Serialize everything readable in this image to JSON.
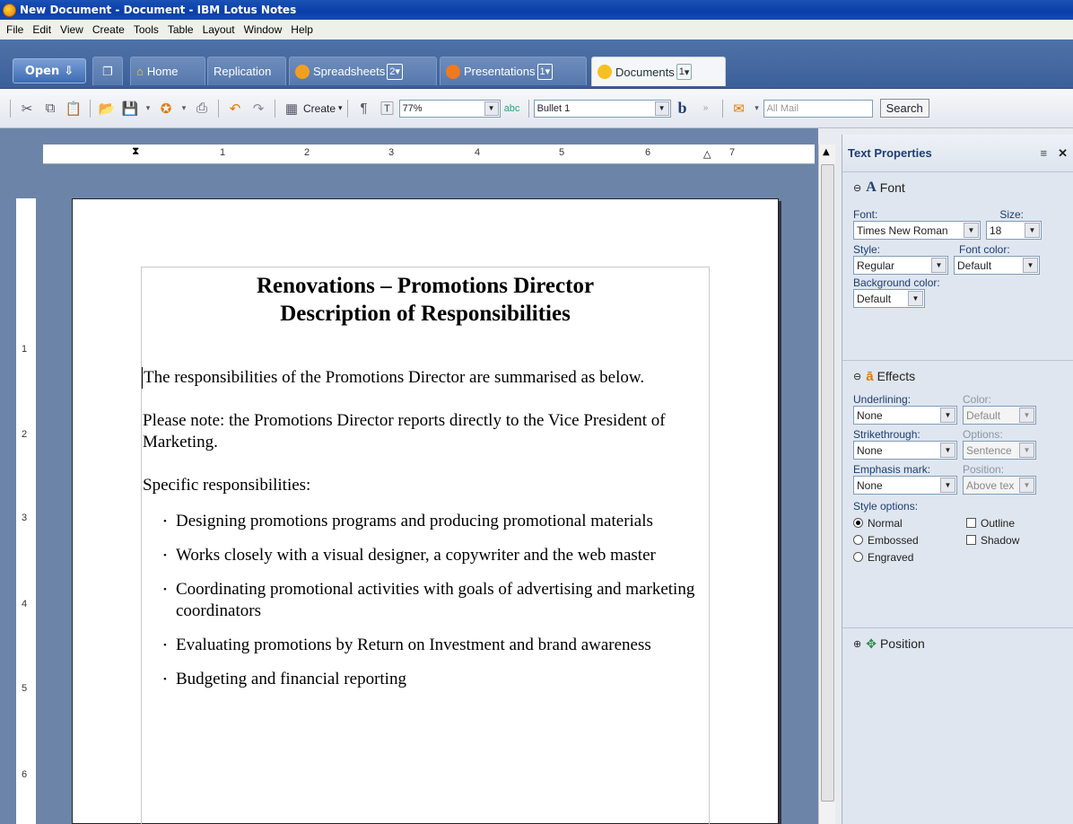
{
  "window": {
    "title": "New Document - Document - IBM Lotus Notes"
  },
  "menu": [
    "File",
    "Edit",
    "View",
    "Create",
    "Tools",
    "Table",
    "Layout",
    "Window",
    "Help"
  ],
  "tabs": {
    "open_label": "Open",
    "home": "Home",
    "replication": "Replication",
    "spreadsheets": "Spreadsheets",
    "spreadsheets_count": "2",
    "presentations": "Presentations",
    "presentations_count": "1",
    "documents": "Documents",
    "documents_count": "1"
  },
  "toolbar": {
    "create_label": "Create",
    "zoom": "77%",
    "paragraph_style": "Bullet 1",
    "bold_glyph": "b",
    "search_placeholder": "All Mail",
    "search_button": "Search"
  },
  "ruler": {
    "h_numbers": [
      "1",
      "2",
      "3",
      "4",
      "5",
      "6",
      "7"
    ],
    "v_numbers": [
      "1",
      "2",
      "3",
      "4",
      "5",
      "6"
    ]
  },
  "document": {
    "title_line1": "Renovations – Promotions Director",
    "title_line2": "Description of Responsibilities",
    "para1": "The responsibilities of the Promotions Director are summarised as below.",
    "para2": "Please note: the Promotions Director reports directly to the Vice President of Marketing.",
    "para3": "Specific responsibilities:",
    "bullets": [
      "Designing promotions programs and producing promotional materials",
      "Works closely with a visual designer, a copywriter and the web master",
      "Coordinating promotional activities with goals of advertising and marketing coordinators",
      "Evaluating promotions by Return on Investment and brand awareness",
      "Budgeting and financial reporting"
    ]
  },
  "panel": {
    "title": "Text Properties",
    "font_section": "Font",
    "font_label": "Font:",
    "font_value": "Times New Roman",
    "size_label": "Size:",
    "size_value": "18",
    "style_label": "Style:",
    "style_value": "Regular",
    "font_color_label": "Font color:",
    "font_color_value": "Default",
    "bg_color_label": "Background color:",
    "bg_color_value": "Default",
    "effects_section": "Effects",
    "underlining_label": "Underlining:",
    "underlining_value": "None",
    "color_label": "Color:",
    "color_value": "Default",
    "strikethrough_label": "Strikethrough:",
    "strikethrough_value": "None",
    "options_label": "Options:",
    "options_value": "Sentence",
    "emphasis_label": "Emphasis mark:",
    "emphasis_value": "None",
    "position_label": "Position:",
    "position_value": "Above tex",
    "style_options_label": "Style options:",
    "normal": "Normal",
    "embossed": "Embossed",
    "engraved": "Engraved",
    "outline": "Outline",
    "shadow": "Shadow",
    "position_section": "Position"
  }
}
